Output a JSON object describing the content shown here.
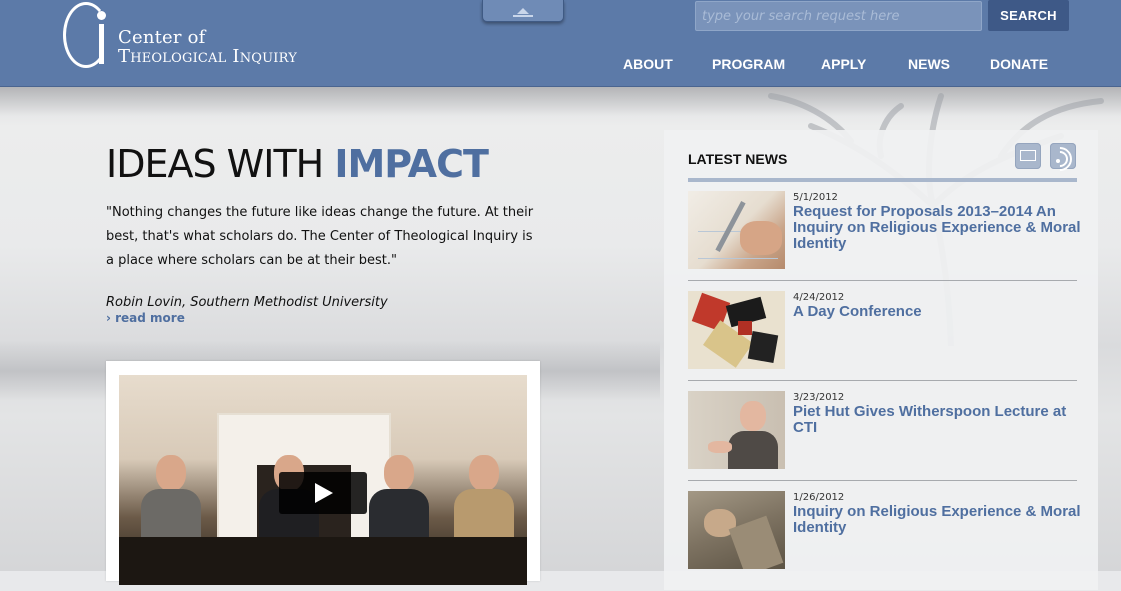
{
  "header": {
    "logo_line1": "Center of",
    "logo_line2": "Theological Inquiry",
    "search_placeholder": "type your search request here",
    "search_button": "SEARCH",
    "nav": [
      {
        "label": "ABOUT"
      },
      {
        "label": "PROGRAM"
      },
      {
        "label": "APPLY"
      },
      {
        "label": "NEWS"
      },
      {
        "label": "DONATE"
      }
    ]
  },
  "hero": {
    "headline_plain": "IDEAS WITH",
    "headline_accent": "IMPACT",
    "quote": "\"Nothing changes the future like ideas change the future. At their best, that's what scholars do. The Center of Theological Inquiry is a place where scholars can be at their best.\"",
    "author": "Robin Lovin, Southern Methodist University",
    "read_more": "› read more"
  },
  "news": {
    "title": "LATEST NEWS",
    "items": [
      {
        "date": "5/1/2012",
        "title": "Request for Proposals 2013–2014 An Inquiry on Religious Experience & Moral Identity",
        "thumb": "hand-writing"
      },
      {
        "date": "4/24/2012",
        "title": "A Day Conference",
        "thumb": "stained-glass"
      },
      {
        "date": "3/23/2012",
        "title": "Piet Hut Gives Witherspoon Lecture at CTI",
        "thumb": "speaker"
      },
      {
        "date": "1/26/2012",
        "title": "Inquiry on Religious Experience & Moral Identity",
        "thumb": "painting"
      }
    ]
  },
  "colors": {
    "header_bg": "#5c7aa8",
    "accent": "#4f6fa0",
    "search_button_bg": "#3e5987"
  }
}
